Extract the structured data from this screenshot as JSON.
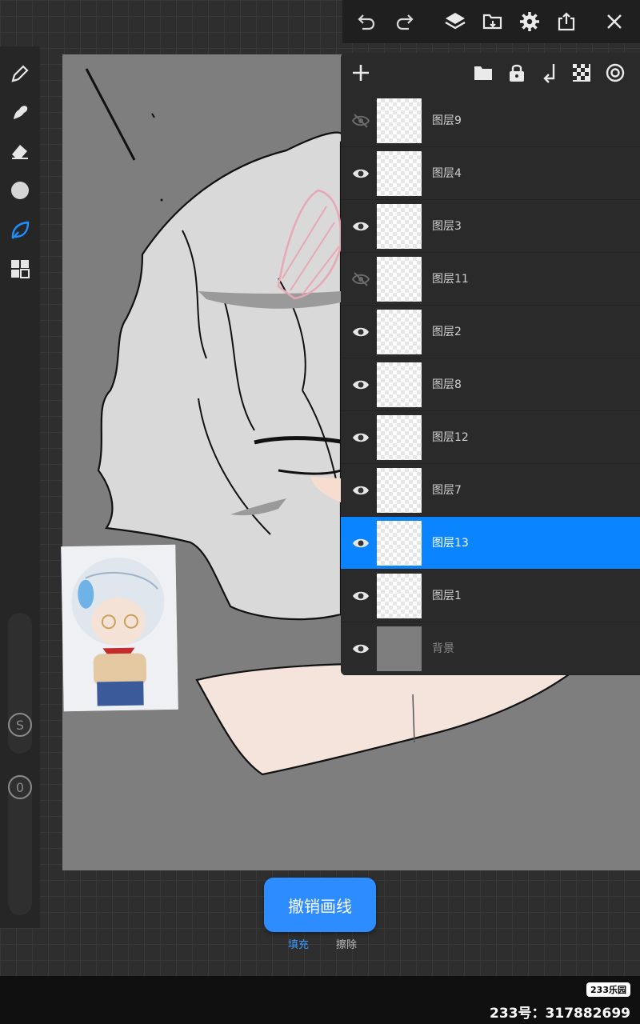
{
  "top_toolbar": {
    "icons": [
      "undo-icon",
      "redo-icon",
      "layers-icon",
      "import-icon",
      "gear-icon",
      "share-icon",
      "close-icon"
    ]
  },
  "left_toolbar": {
    "tools": [
      "brush-icon",
      "smudge-icon",
      "eraser-icon",
      "color-icon",
      "lasso-icon",
      "gallery-icon"
    ],
    "active_tool": "lasso-icon",
    "accent": "#1e90ff",
    "size_label": "S",
    "opacity_label": "0"
  },
  "layers_panel": {
    "header_icons": [
      "add-icon",
      "folder-icon",
      "lock-icon",
      "merge-down-icon",
      "checker-icon",
      "target-icon"
    ],
    "layers": [
      {
        "name": "图层9",
        "visible": false
      },
      {
        "name": "图层4",
        "visible": true
      },
      {
        "name": "图层3",
        "visible": true
      },
      {
        "name": "图层11",
        "visible": false
      },
      {
        "name": "图层2",
        "visible": true
      },
      {
        "name": "图层8",
        "visible": true
      },
      {
        "name": "图层12",
        "visible": true
      },
      {
        "name": "图层7",
        "visible": true
      },
      {
        "name": "图层13",
        "visible": true,
        "selected": true
      },
      {
        "name": "图层1",
        "visible": true
      },
      {
        "name": "背景",
        "visible": true
      }
    ],
    "selected_color": "#0a84ff"
  },
  "action_button": {
    "label": "撤销画线"
  },
  "modes": {
    "fill": "填充",
    "erase": "擦除",
    "active": "fill"
  },
  "watermark": {
    "logo": "233乐园",
    "text": "233号：317882699"
  }
}
